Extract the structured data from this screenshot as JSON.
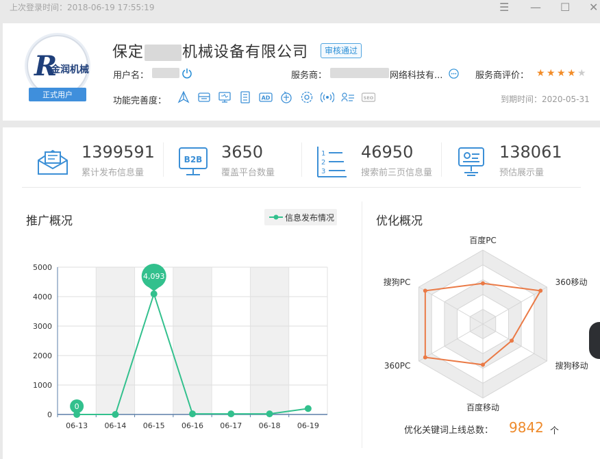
{
  "titlebar": {
    "last_login": "上次登录时间：2018-06-19 17:55:19"
  },
  "profile": {
    "logo_text": "金润机械",
    "logo_badge": "正式用户",
    "company_prefix": "保定",
    "company_suffix": "机械设备有限公司",
    "status_badge": "审核通过",
    "username_label": "用户名：",
    "provider_label": "服务商：",
    "provider_suffix": "网络科技有...",
    "rating_label": "服务商评价：",
    "rating": 4,
    "rating_max": 5,
    "completeness_label": "功能完善度：",
    "completeness_icons": [
      "arrow-up-icon",
      "inbox-icon",
      "monitor-icon",
      "document-icon",
      "ad-icon",
      "circle-text-icon",
      "gear-flower-icon",
      "broadcast-icon",
      "user-list-icon",
      "seo-icon"
    ],
    "ad_text": "AD",
    "seo_text": "SEO",
    "expire": "到期时间：2020-05-31"
  },
  "stats": [
    {
      "value": "1399591",
      "label": "累计发布信息量",
      "icon": "envelope-icon"
    },
    {
      "value": "3650",
      "label": "覆盖平台数量",
      "icon": "b2b-icon",
      "icon_text": "B2B"
    },
    {
      "value": "46950",
      "label": "搜索前三页信息量",
      "icon": "ranked-list-icon",
      "icon_text": [
        "1",
        "2",
        "3"
      ]
    },
    {
      "value": "138061",
      "label": "预估展示量",
      "icon": "display-board-icon"
    }
  ],
  "promo": {
    "title": "推广概况",
    "legend": "信息发布情况"
  },
  "optimize": {
    "title": "优化概况",
    "total_label": "优化关键词上线总数：",
    "total_value": "9842",
    "total_unit": "个"
  },
  "chart_data": [
    {
      "type": "line",
      "categories": [
        "06-13",
        "06-14",
        "06-15",
        "06-16",
        "06-17",
        "06-18",
        "06-19"
      ],
      "series": [
        {
          "name": "信息发布情况",
          "values": [
            0,
            0,
            4093,
            20,
            20,
            20,
            200
          ]
        }
      ],
      "ylim": [
        0,
        5000
      ],
      "yticks": [
        "0",
        "1000",
        "2000",
        "3000",
        "4000",
        "5000"
      ],
      "data_labels": [
        {
          "category": "06-13",
          "text": "0"
        },
        {
          "category": "06-15",
          "text": "4,093"
        }
      ],
      "grid": true,
      "legend": "top-right",
      "color": "#32c08d"
    },
    {
      "type": "radar",
      "axes": [
        "百度PC",
        "360移动",
        "搜狗移动",
        "百度移动",
        "360PC",
        "搜狗PC"
      ],
      "max": 1,
      "values": [
        0.55,
        0.9,
        0.45,
        0.55,
        0.9,
        0.9
      ],
      "color": "#ea7a46"
    }
  ],
  "colors": {
    "accent": "#2b8fd6",
    "line": "#32c08d",
    "radar": "#ea7a46",
    "star_on": "#f28c28",
    "star_off": "#cccccc",
    "total": "#ee8a2b"
  }
}
